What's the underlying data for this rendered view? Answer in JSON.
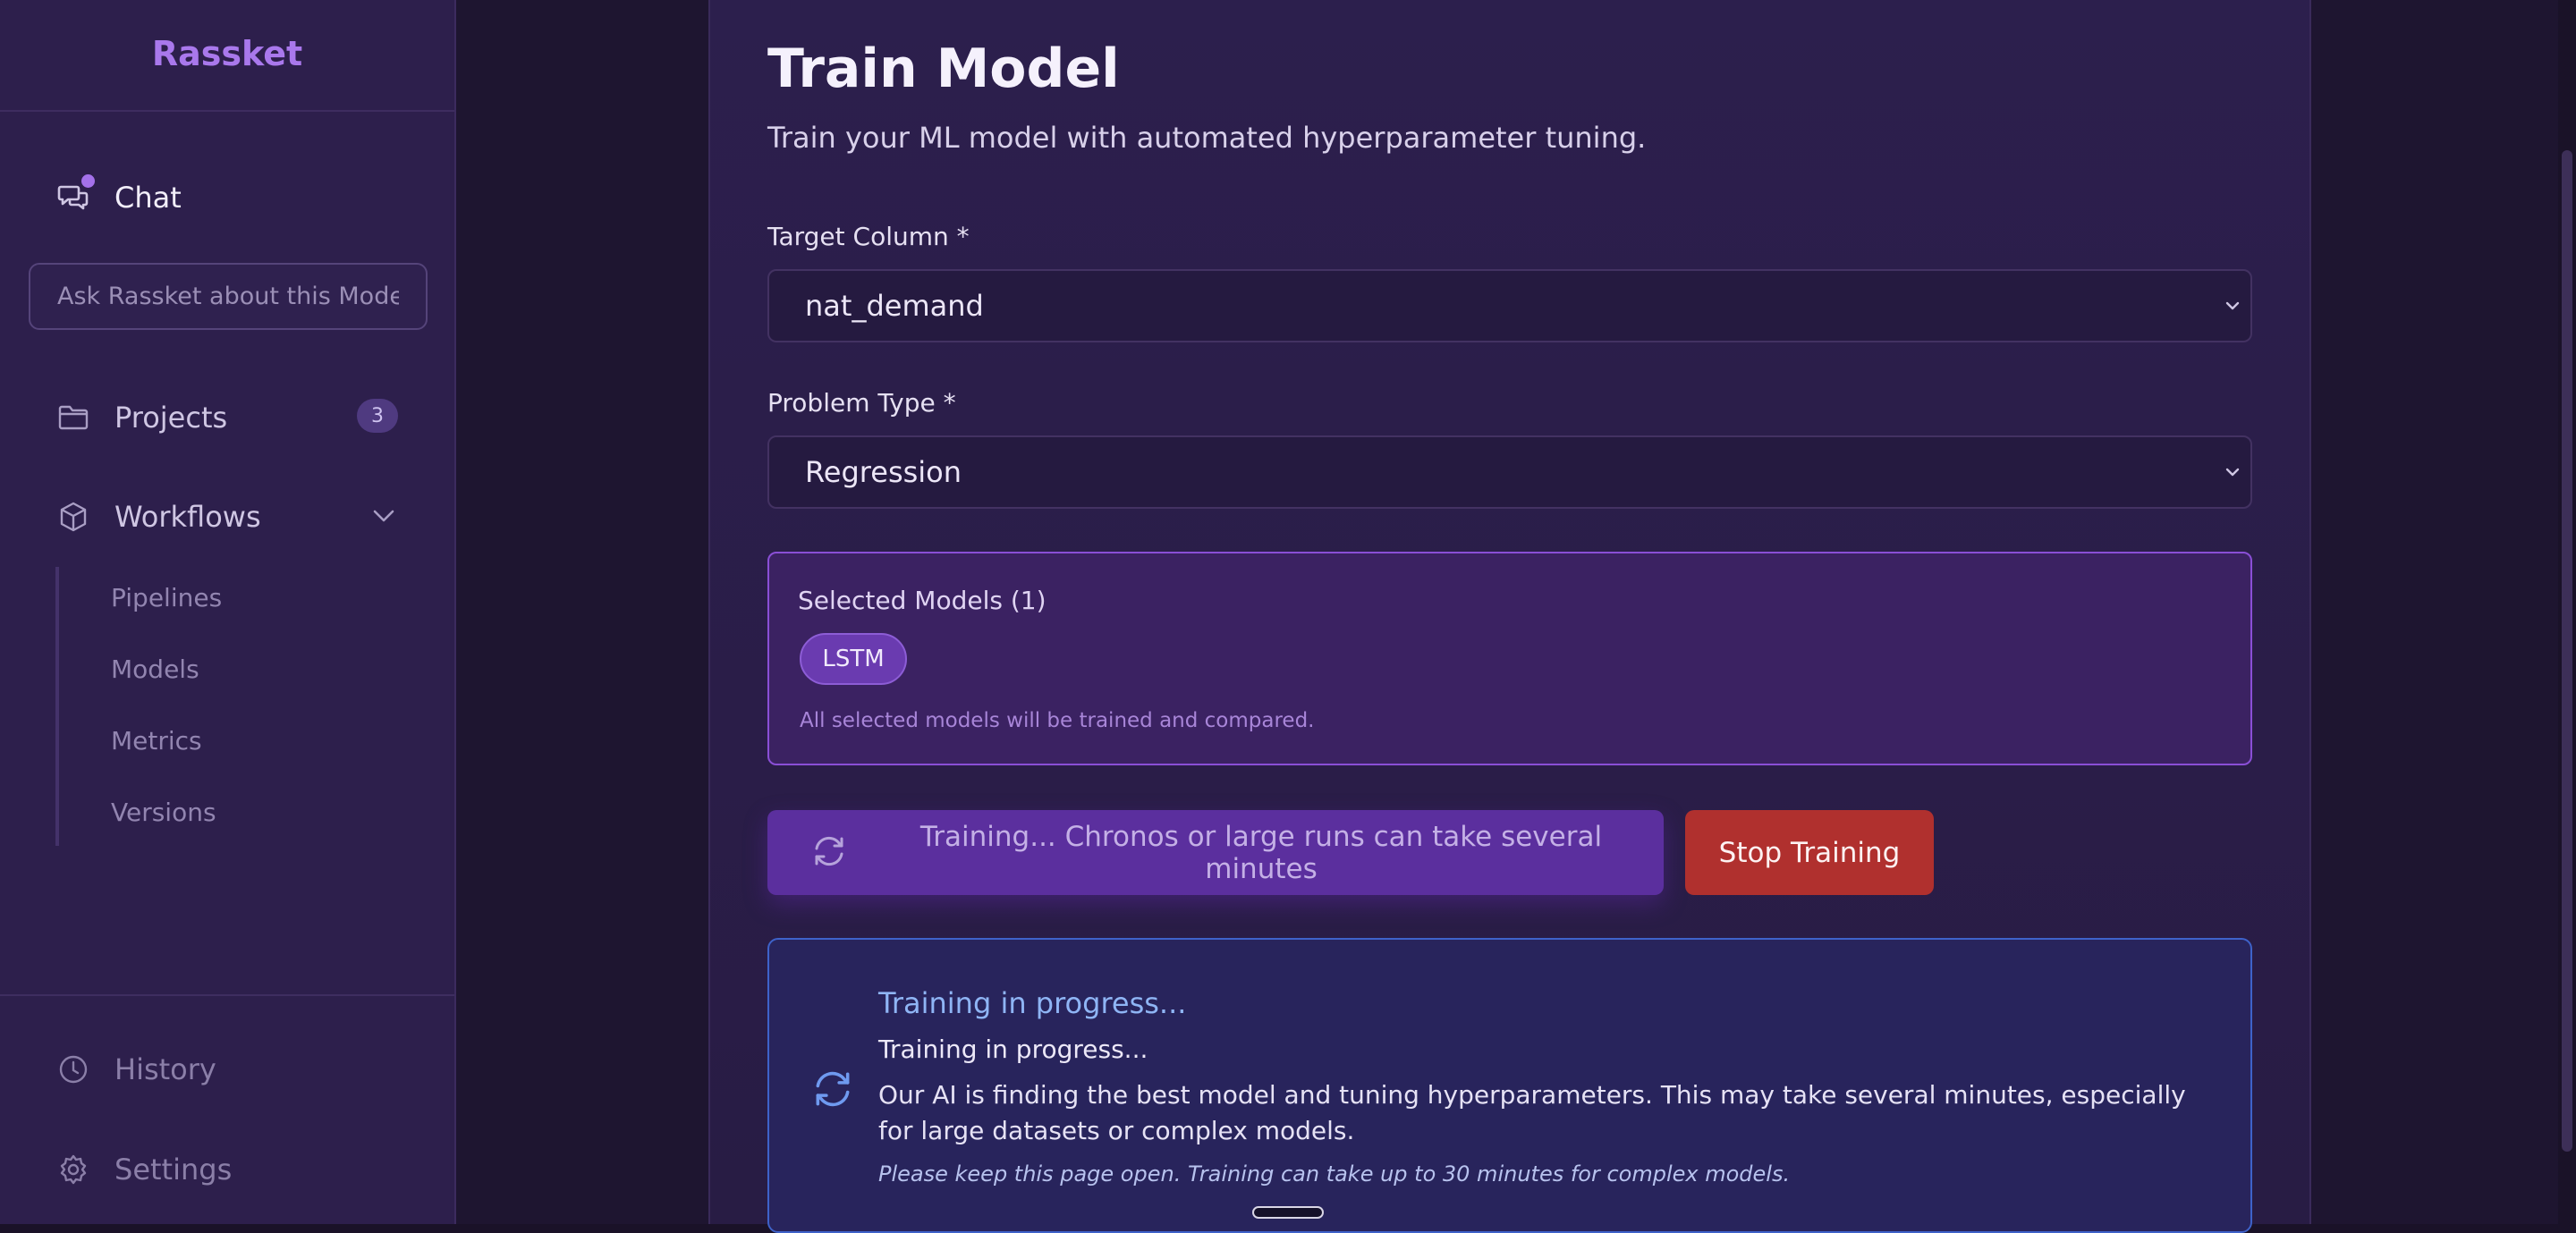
{
  "sidebar": {
    "brand": "Rassket",
    "chat_label": "Chat",
    "ask_placeholder": "Ask Rassket about this Model",
    "projects_label": "Projects",
    "projects_count": "3",
    "workflows_label": "Workflows",
    "workflow_items": [
      "Pipelines",
      "Models",
      "Metrics",
      "Versions"
    ],
    "history_label": "History",
    "settings_label": "Settings"
  },
  "main": {
    "title": "Train Model",
    "subtitle": "Train your ML model with automated hyperparameter tuning.",
    "target_label": "Target Column *",
    "target_value": "nat_demand",
    "problem_label": "Problem Type *",
    "problem_value": "Regression",
    "selected_title": "Selected Models (1)",
    "selected_chip": "LSTM",
    "selected_note": "All selected models will be trained and compared.",
    "train_button": "Training... Chronos or large runs can take several minutes",
    "stop_button": "Stop Training",
    "progress_title": "Training in progress...",
    "progress_line": "Training in progress...",
    "progress_desc": "Our AI is finding the best model and tuning hyperparameters. This may take several minutes, especially for large datasets or complex models.",
    "progress_note": "Please keep this page open. Training can take up to 30 minutes for complex models."
  },
  "colors": {
    "accent": "#a978ec",
    "stop": "#b0302e",
    "info_border": "#3e62c9"
  }
}
